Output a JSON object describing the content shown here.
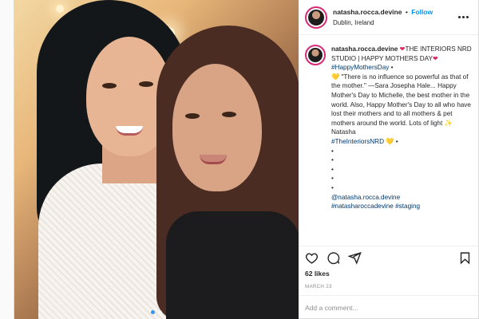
{
  "post": {
    "username": "natasha.rocca.devine",
    "follow_label": "Follow",
    "separator": "•",
    "location": "Dublin, Ireland",
    "photo_index": 0,
    "photo_count": 2
  },
  "caption": {
    "username": "natasha.rocca.devine",
    "heart_glyph": "❤",
    "text_1": "THE INTERIORS NRD STUDIO | HAPPY MOTHERS DAY",
    "hashtag_1": "#HappyMothersDay",
    "bullet": "•",
    "yellow_heart_glyph": "💛",
    "text_2": "\"There is no influence so powerful as that of the mother.\" —Sara Josepha Hale... Happy Mother's Day to Michelle, the best mother in the world. Also, Happy Mother's Day to all who have lost their mothers and to all mothers & pet mothers around the world. Lots of light",
    "sparkle_glyph": "✨",
    "sign": "Natasha",
    "hashtag_2": "#TheInteriorsNRD",
    "dots": [
      "•",
      "•",
      "•",
      "•",
      "•"
    ],
    "mention": "@natasha.rocca.devine",
    "more_tags": "#natasharoccadevine #staging"
  },
  "footer": {
    "likes": "62 likes",
    "date": "MARCH 23",
    "comment_placeholder": "Add a comment..."
  },
  "icons": {
    "like": "heart-outline-icon",
    "comment": "comment-bubble-icon",
    "share": "paper-plane-icon",
    "save": "bookmark-icon",
    "more": "ellipsis-icon"
  },
  "colors": {
    "link": "#0095f6",
    "hashtag": "#00376b",
    "heart": "#e0245e",
    "story_ring": "#d62976"
  }
}
